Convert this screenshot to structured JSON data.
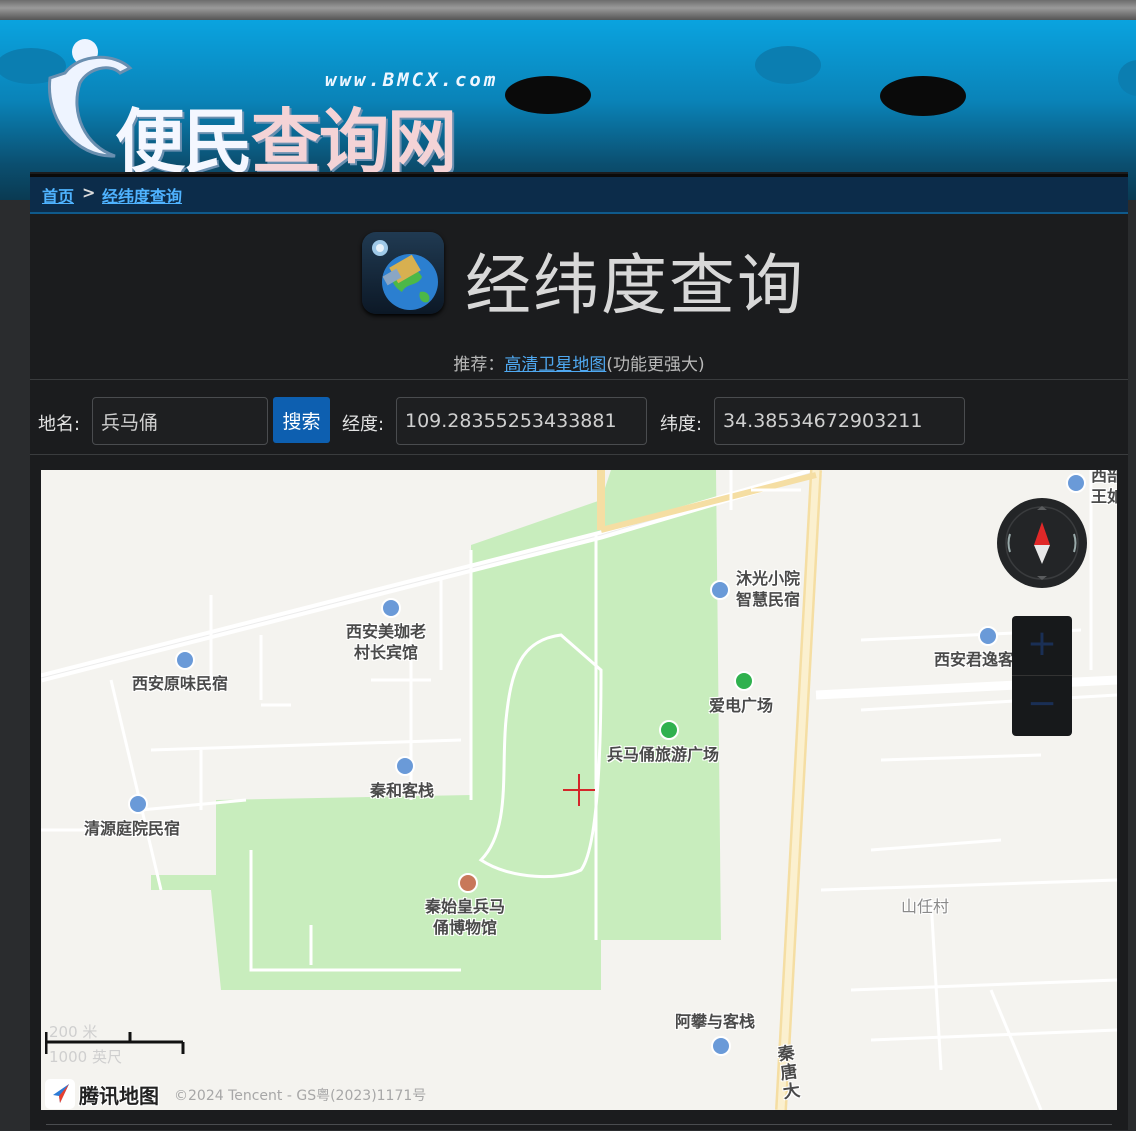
{
  "banner": {
    "logo_url": "www.BMCX.com",
    "logo_main_1": "便民",
    "logo_main_2": "查询网"
  },
  "breadcrumb": {
    "home": "首页",
    "separator": ">",
    "current": "经纬度查询"
  },
  "page": {
    "title": "经纬度查询",
    "recommend_prefix": "推荐：",
    "recommend_link": "高清卫星地图",
    "recommend_suffix": "(功能更强大)"
  },
  "form": {
    "place_label": "地名:",
    "place_value": "兵马俑",
    "search_button": "搜索",
    "lng_label": "经度:",
    "lng_value": "109.28355253433881",
    "lat_label": "纬度:",
    "lat_value": "34.38534672903211"
  },
  "map": {
    "pois": {
      "yuanwei": "西安原味民宿",
      "meijia_1": "西安美珈老",
      "meijia_2": "村长宾馆",
      "muguang_1": "沐光小院",
      "muguang_2": "智慧民宿",
      "junyi": "西安君逸客",
      "aidian": "爱电广场",
      "bmy_square": "兵马俑旅游广场",
      "qinhe": "秦和客栈",
      "qingyuan": "清源庭院民宿",
      "museum_1": "秦始皇兵马",
      "museum_2": "俑博物馆",
      "shanren": "山任村",
      "apan": "阿攀与客栈",
      "road": "秦唐大",
      "corner_1": "西部",
      "corner_2": "王如"
    },
    "scale_m": "200 米",
    "scale_ft": "1000 英尺",
    "brand": "腾讯地图",
    "copyright": "©2024 Tencent - GS粤(2023)1171号",
    "zoom_in": "+",
    "zoom_out": "−"
  },
  "colors": {
    "banner": "#0a83b8",
    "link": "#4fb3ff",
    "search_button": "#0d5fb0",
    "park": "#c8edbd"
  }
}
